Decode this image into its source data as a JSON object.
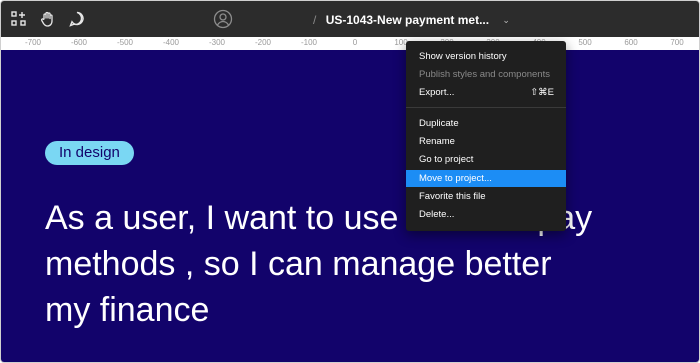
{
  "toolbar": {
    "tools": [
      "frame-tool-icon",
      "hand-icon",
      "comment-icon"
    ],
    "avatar_icon": "user-avatar-icon",
    "breadcrumb_separator": "/",
    "file_title": "US-1043-New payment met...",
    "chevron": "⌄"
  },
  "ruler": {
    "ticks": [
      "-700",
      "-600",
      "-500",
      "-400",
      "-300",
      "-200",
      "-100",
      "0",
      "100",
      "200",
      "300",
      "400",
      "500",
      "600",
      "700"
    ]
  },
  "canvas": {
    "status_pill": "In design",
    "headline": "As a user, I want to use different pay methods , so I can manage better my finance",
    "headline_line1": "As a user, I want to use",
    "headline_line1_end": "t pay",
    "headline_line2": "methods , so I can manage better",
    "headline_line3": "my finance"
  },
  "menu": {
    "items": [
      {
        "label": "Show version history",
        "state": "normal"
      },
      {
        "label": "Publish styles and components",
        "state": "disabled"
      },
      {
        "label": "Export...",
        "state": "normal",
        "shortcut": "⇧⌘E"
      },
      {
        "label": "Duplicate",
        "state": "normal"
      },
      {
        "label": "Rename",
        "state": "normal"
      },
      {
        "label": "Go to project",
        "state": "normal"
      },
      {
        "label": "Move to project...",
        "state": "active"
      },
      {
        "label": "Favorite this file",
        "state": "normal"
      },
      {
        "label": "Delete...",
        "state": "normal"
      }
    ]
  },
  "colors": {
    "toolbar_bg": "#2c2c2c",
    "canvas_bg": "#12036b",
    "pill_bg": "#7ad7f3",
    "menu_bg": "#1f1f1f",
    "menu_highlight": "#1c8df5"
  }
}
